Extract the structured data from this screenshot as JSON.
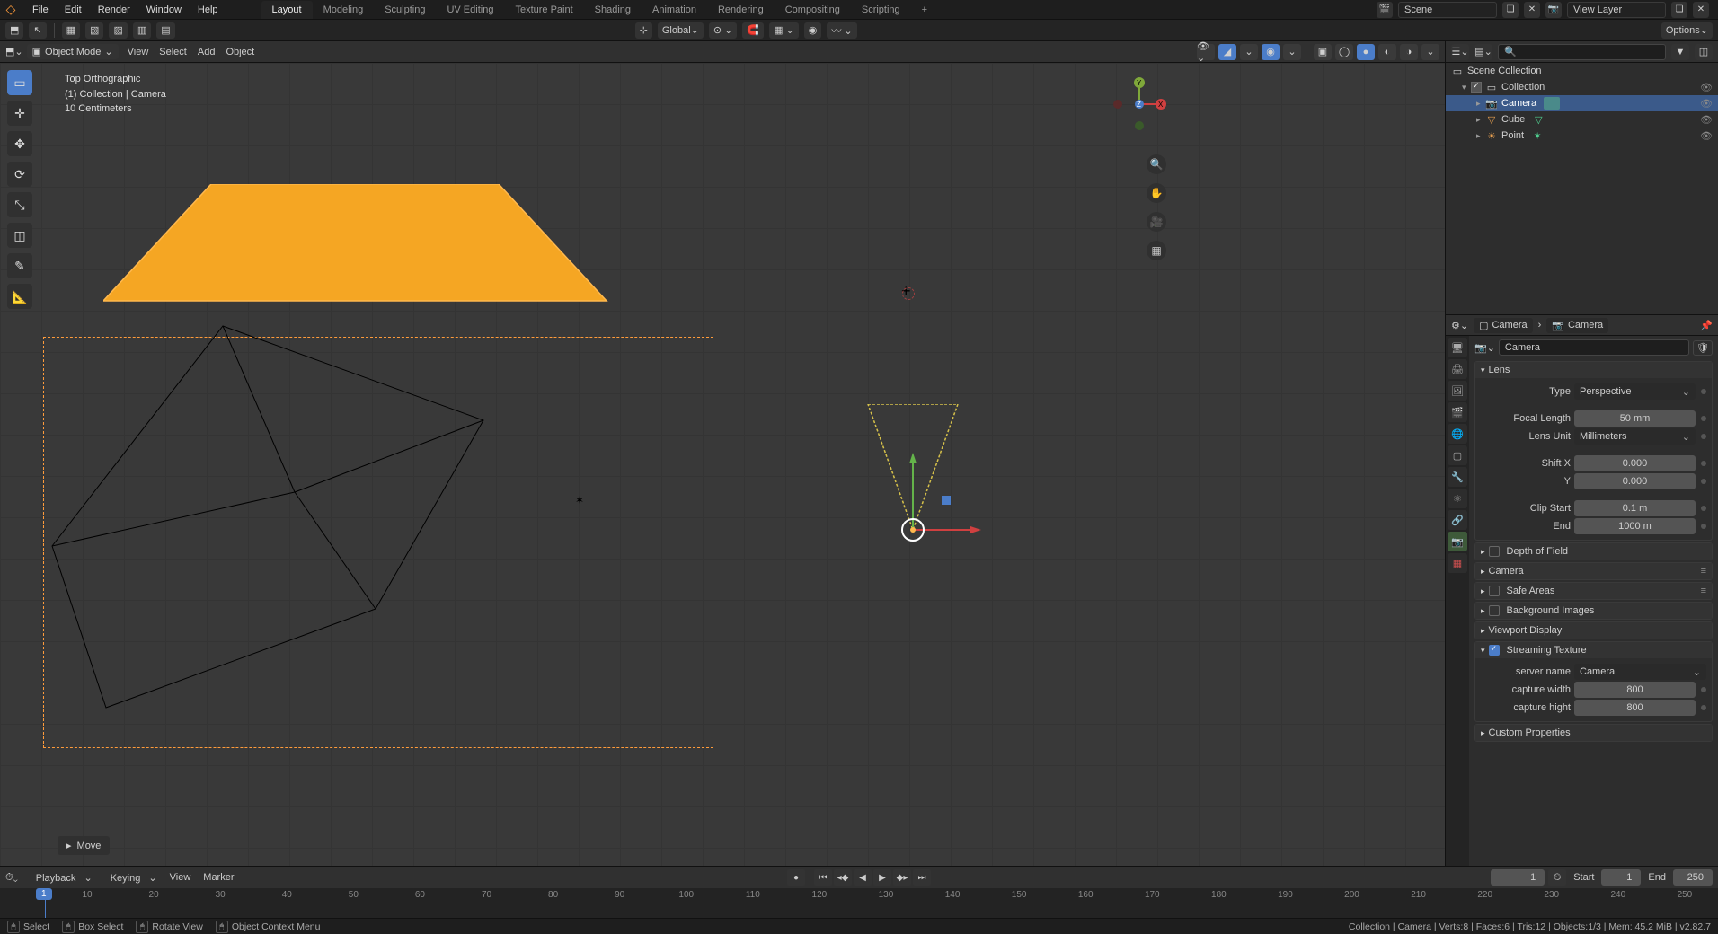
{
  "topmenu": {
    "items": [
      "File",
      "Edit",
      "Render",
      "Window",
      "Help"
    ]
  },
  "workspaces": {
    "items": [
      "Layout",
      "Modeling",
      "Sculpting",
      "UV Editing",
      "Texture Paint",
      "Shading",
      "Animation",
      "Rendering",
      "Compositing",
      "Scripting"
    ],
    "active": 0
  },
  "scene_field": {
    "value": "Scene"
  },
  "viewlayer_field": {
    "label": "View Layer"
  },
  "header2": {
    "orientation": "Global",
    "options": "Options"
  },
  "viewport": {
    "mode": "Object Mode",
    "menus": [
      "View",
      "Select",
      "Add",
      "Object"
    ],
    "info": {
      "proj": "Top Orthographic",
      "path": "(1) Collection | Camera",
      "scale": "10 Centimeters"
    },
    "last_op": "Move"
  },
  "axis": {
    "labels": {
      "x": "X",
      "y": "Y",
      "z": "Z"
    }
  },
  "outliner": {
    "root": "Scene Collection",
    "collection": "Collection",
    "items": [
      {
        "name": "Camera",
        "kind": "camera",
        "selected": true
      },
      {
        "name": "Cube",
        "kind": "mesh",
        "selected": false
      },
      {
        "name": "Point",
        "kind": "light",
        "selected": false
      }
    ]
  },
  "props": {
    "crumb1": "Camera",
    "crumb2": "Camera",
    "datablock": "Camera",
    "panels": {
      "lens": {
        "title": "Lens",
        "type_lbl": "Type",
        "type_val": "Perspective",
        "focal_lbl": "Focal Length",
        "focal_val": "50 mm",
        "unit_lbl": "Lens Unit",
        "unit_val": "Millimeters",
        "shiftx_lbl": "Shift X",
        "shiftx_val": "0.000",
        "shifty_lbl": "Y",
        "shifty_val": "0.000",
        "clips_lbl": "Clip Start",
        "clips_val": "0.1 m",
        "clipe_lbl": "End",
        "clipe_val": "1000 m"
      },
      "dof": {
        "title": "Depth of Field"
      },
      "camera": {
        "title": "Camera"
      },
      "safe": {
        "title": "Safe Areas"
      },
      "bg": {
        "title": "Background Images"
      },
      "vd": {
        "title": "Viewport Display"
      },
      "stream": {
        "title": "Streaming Texture",
        "server_lbl": "server name",
        "server_val": "Camera",
        "cw_lbl": "capture width",
        "cw_val": "800",
        "ch_lbl": "capture hight",
        "ch_val": "800"
      },
      "custom": {
        "title": "Custom Properties"
      }
    }
  },
  "timeline": {
    "menus": [
      "Playback",
      "Keying",
      "View",
      "Marker"
    ],
    "current": "1",
    "start_lbl": "Start",
    "start": "1",
    "end_lbl": "End",
    "end": "250",
    "ticks": [
      "10",
      "20",
      "30",
      "40",
      "50",
      "60",
      "70",
      "80",
      "90",
      "100",
      "110",
      "120",
      "130",
      "140",
      "150",
      "160",
      "170",
      "180",
      "190",
      "200",
      "210",
      "220",
      "230",
      "240",
      "250"
    ]
  },
  "status": {
    "select": "Select",
    "box": "Box Select",
    "rotate": "Rotate View",
    "ctx": "Object Context Menu",
    "right": "Collection | Camera | Verts:8 | Faces:6 | Tris:12 | Objects:1/3 | Mem: 45.2 MiB | v2.82.7"
  }
}
